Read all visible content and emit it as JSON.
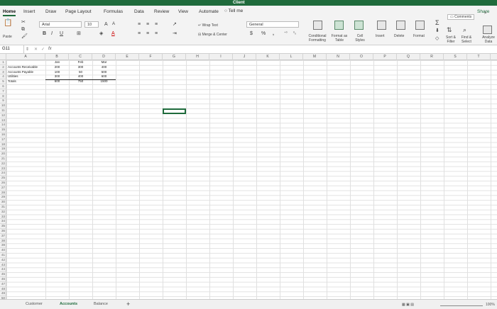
{
  "window": {
    "title": "Client"
  },
  "tabs": [
    "Home",
    "Insert",
    "Draw",
    "Page Layout",
    "Formulas",
    "Data",
    "Review",
    "View",
    "Automate"
  ],
  "tell_me": "Tell me",
  "ribbon": {
    "font_name": "Arial",
    "font_size": "10",
    "font_grow": "A",
    "font_shrink": "A",
    "bold": "B",
    "italic": "I",
    "underline": "U",
    "paste": "Paste",
    "wrap_text": "Wrap Text",
    "merge_center": "Merge & Center",
    "number_format": "General",
    "currency": "$",
    "percent": "%",
    "comma": ",",
    "conditional_formatting": "Conditional Formatting",
    "format_as_table": "Format as Table",
    "cell_styles": "Cell Styles",
    "insert": "Insert",
    "delete": "Delete",
    "format": "Format",
    "sort_filter": "Sort & Filter",
    "find_select": "Find & Select",
    "analyze_data": "Analyze Data",
    "comments": "Comments",
    "share": "Share"
  },
  "formula_bar": {
    "name_box": "G11",
    "fx": "fx",
    "content": ""
  },
  "columns": [
    "A",
    "B",
    "C",
    "D",
    "E",
    "F",
    "G",
    "H",
    "I",
    "J",
    "K",
    "L",
    "M",
    "N",
    "O",
    "P",
    "Q",
    "R",
    "S",
    "T",
    "U",
    "V",
    "W",
    "X"
  ],
  "rows": [
    "1",
    "2",
    "3",
    "4",
    "5",
    "6",
    "7",
    "8",
    "9",
    "10",
    "11",
    "12",
    "13",
    "14",
    "15",
    "16",
    "17",
    "18",
    "19",
    "20",
    "21",
    "22",
    "23",
    "24",
    "25",
    "26",
    "27",
    "28",
    "29",
    "30",
    "31",
    "32",
    "33",
    "34",
    "35",
    "36",
    "37",
    "38",
    "39",
    "40",
    "41",
    "42",
    "43",
    "44",
    "45",
    "46",
    "47",
    "48",
    "49",
    "50"
  ],
  "table": {
    "headers": [
      "Jan",
      "Feb",
      "Mar"
    ],
    "rows": [
      {
        "label": "Accounts Receivable",
        "values": [
          "200",
          "300",
          "400"
        ]
      },
      {
        "label": "Accounts Payable",
        "values": [
          "100",
          "50",
          "500"
        ]
      },
      {
        "label": "Utilities",
        "values": [
          "300",
          "400",
          "600"
        ]
      },
      {
        "label": "Totals",
        "values": [
          "600",
          "750",
          "1500"
        ]
      }
    ]
  },
  "sheets": [
    {
      "name": "Customer",
      "active": false
    },
    {
      "name": "Accounts",
      "active": true
    },
    {
      "name": "Balance",
      "active": false
    }
  ],
  "zoom": "100%"
}
